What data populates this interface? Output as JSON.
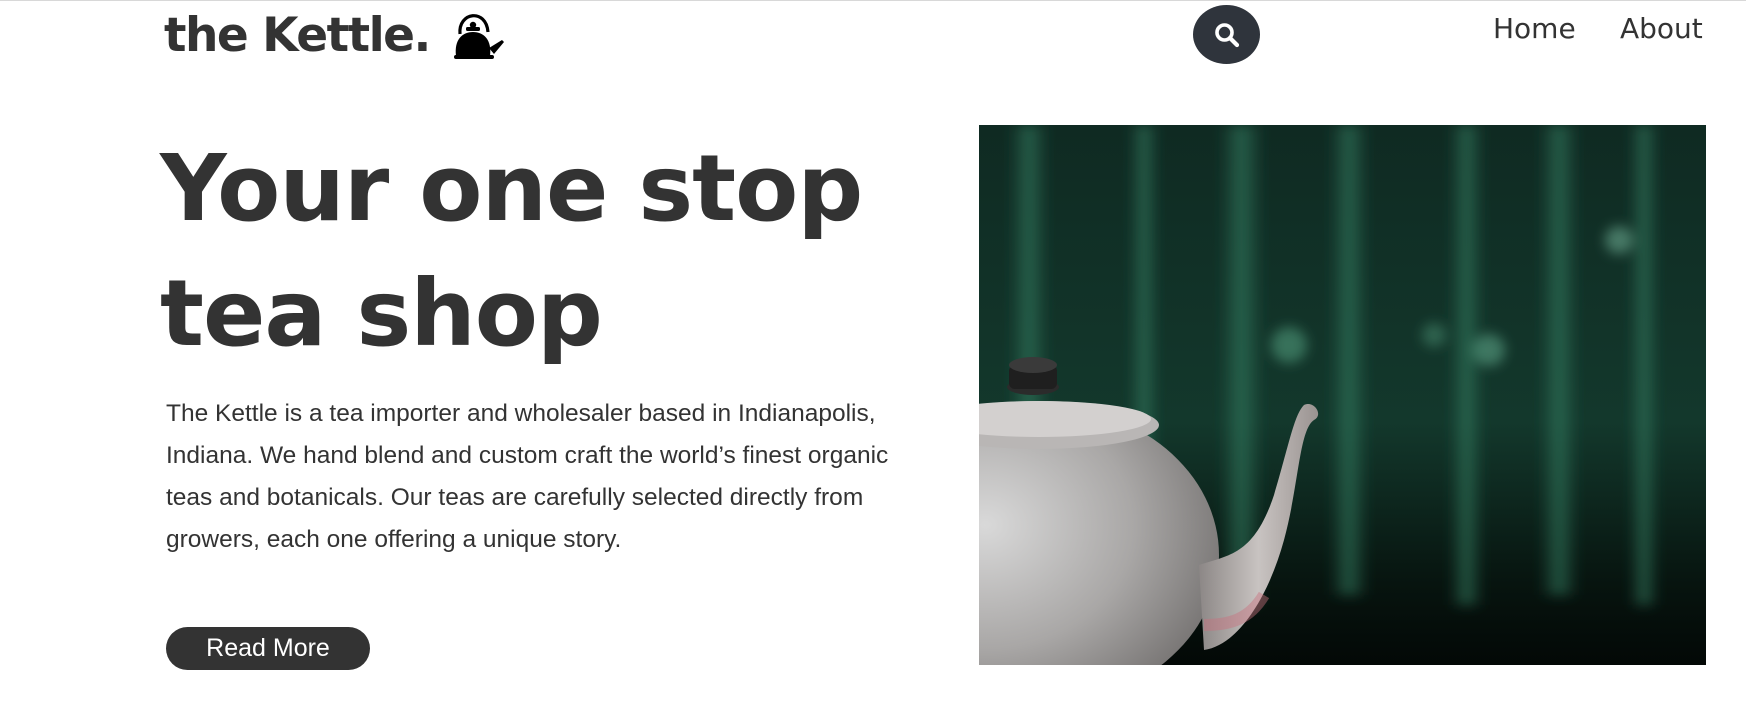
{
  "header": {
    "brand": "the Kettle.",
    "logo_icon": "kettle-icon",
    "search_icon": "search-icon",
    "nav": [
      {
        "label": "Home"
      },
      {
        "label": "About"
      }
    ]
  },
  "hero": {
    "title_line1": "Your one stop",
    "title_line2": "tea shop",
    "description": "The Kettle is a tea importer and wholesaler based in Indianapolis, Indiana. We hand blend and custom craft the world’s finest organic teas and botanicals. Our teas are carefully selected directly from growers, each one offering a unique story.",
    "button_label": "Read More",
    "image": "teapot-photo"
  },
  "colors": {
    "text": "#333333",
    "search_bg": "#2f343c",
    "button_bg": "#333333",
    "background": "#ffffff"
  }
}
